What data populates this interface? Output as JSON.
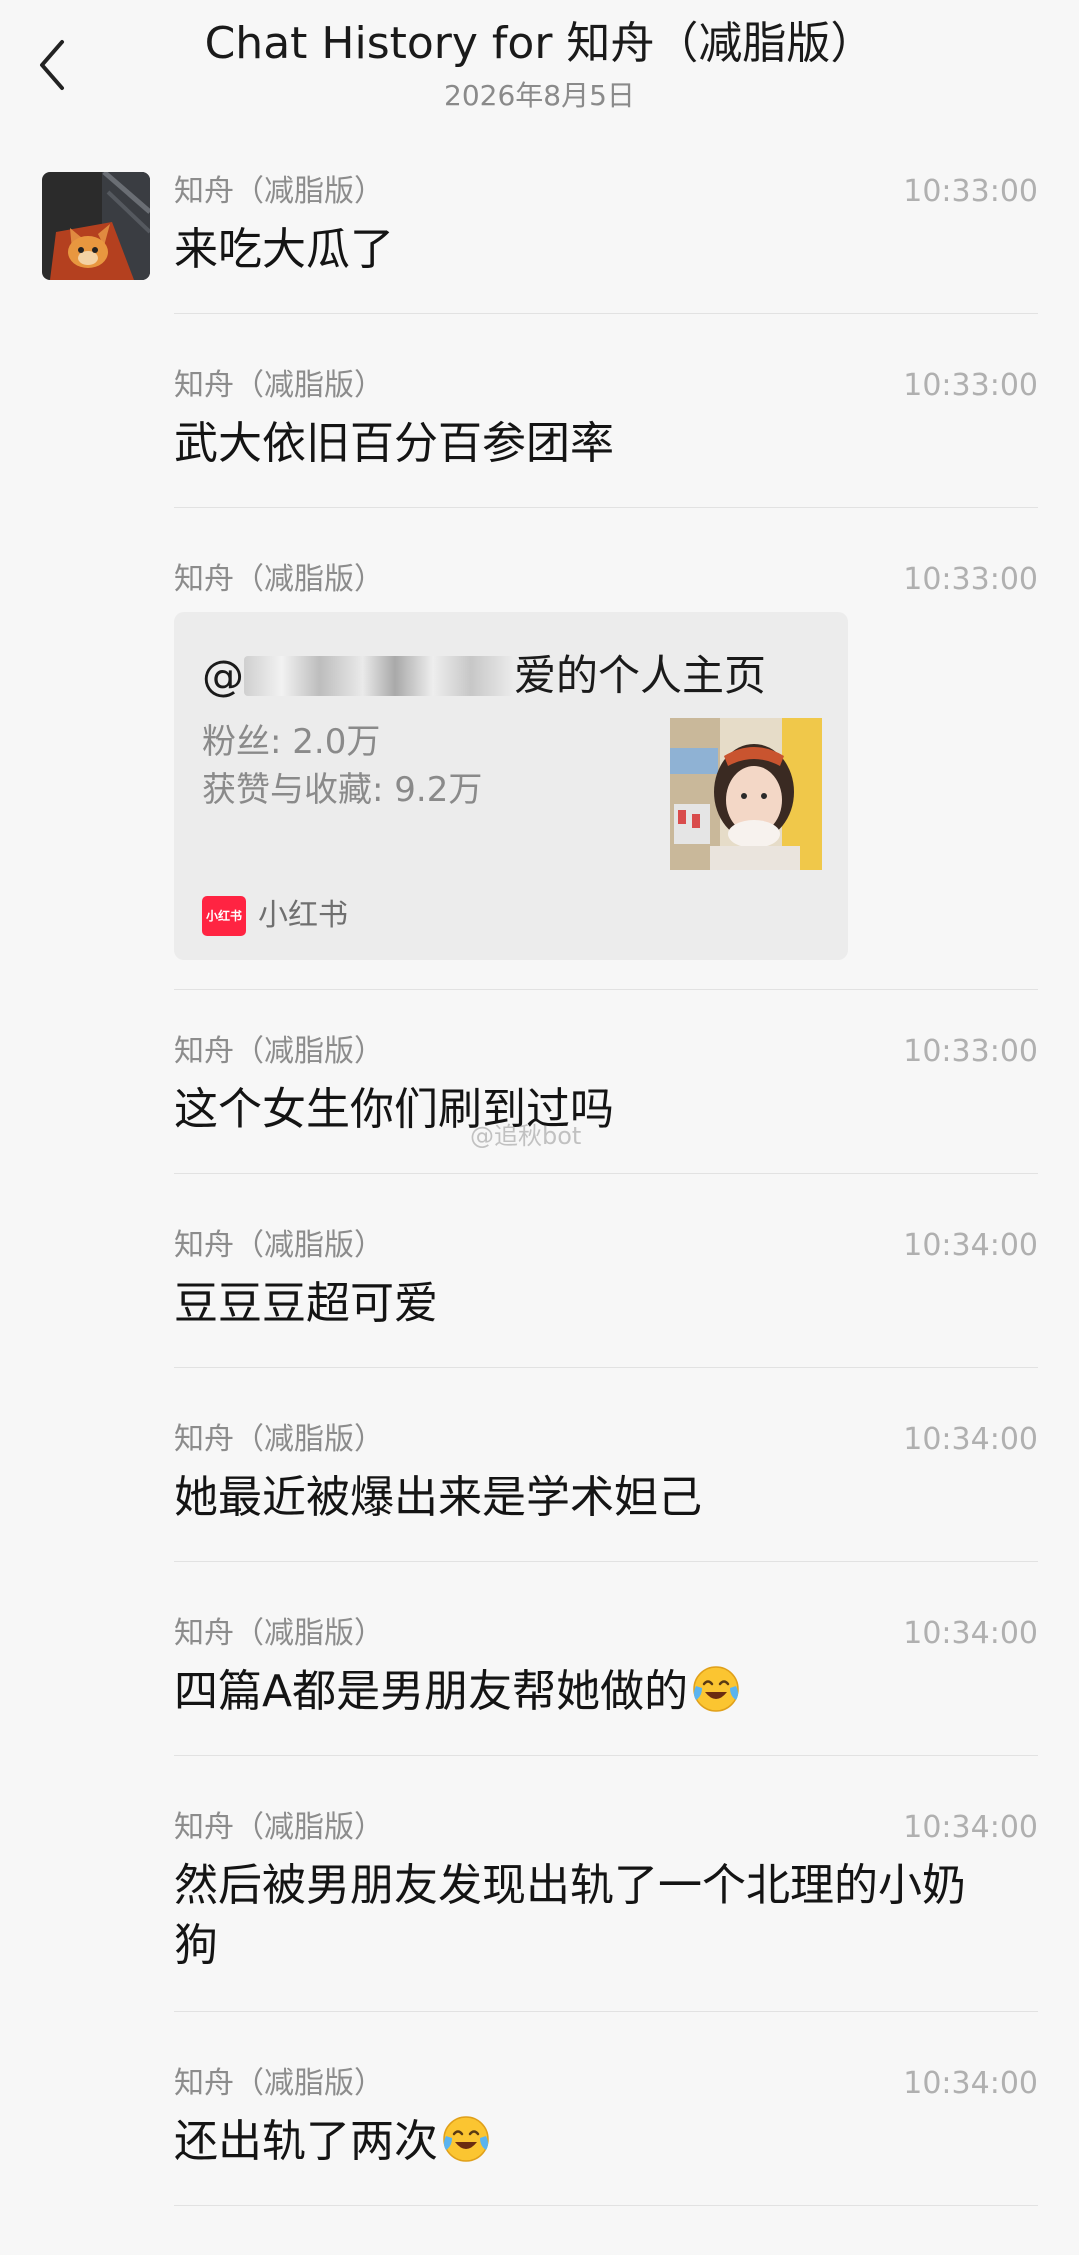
{
  "header": {
    "title": "Chat History for 知舟（减脂版）",
    "date": "2026年8月5日"
  },
  "messages": [
    {
      "sender": "知舟（减脂版）",
      "time": "10:33:00",
      "text": "来吃大瓜了"
    },
    {
      "sender": "知舟（减脂版）",
      "time": "10:33:00",
      "text": "武大依旧百分百参团率"
    },
    {
      "sender": "知舟（减脂版）",
      "time": "10:33:00",
      "card": {
        "title_prefix": "@",
        "title_suffix": "爱的个人主页",
        "fans_label": "粉丝: 2.0万",
        "likes_label": "获赞与收藏: 9.2万",
        "source_logo": "小红书",
        "source_name": "小红书"
      }
    },
    {
      "sender": "知舟（减脂版）",
      "time": "10:33:00",
      "text": "这个女生你们刷到过吗"
    },
    {
      "sender": "知舟（减脂版）",
      "time": "10:34:00",
      "text": "豆豆豆超可爱"
    },
    {
      "sender": "知舟（减脂版）",
      "time": "10:34:00",
      "text": "她最近被爆出来是学术妲己"
    },
    {
      "sender": "知舟（减脂版）",
      "time": "10:34:00",
      "text": "四篇A都是男朋友帮她做的",
      "emoji": "crying-laughing-emoji"
    },
    {
      "sender": "知舟（减脂版）",
      "time": "10:34:00",
      "text": "然后被男朋友发现出轨了一个北理的小奶狗"
    },
    {
      "sender": "知舟（减脂版）",
      "time": "10:34:00",
      "text": "还出轨了两次",
      "emoji": "crying-laughing-emoji"
    }
  ],
  "watermark": "@追秋bot",
  "colors": {
    "background": "#f7f7f7",
    "card": "#ececec",
    "xiaohongshu_red": "#ff2442"
  }
}
